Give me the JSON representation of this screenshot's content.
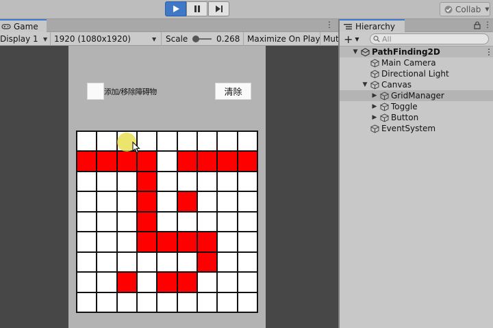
{
  "toolbar": {
    "collab_label": "Collab"
  },
  "game": {
    "tab_label": "Game",
    "display_label": "Display 1",
    "resolution_label": "1920 (1080x1920)",
    "scale_label": "Scale",
    "scale_value": "0.268",
    "maximize_label": "Maximize On Play",
    "mute_label": "Mut",
    "toggle_label": "添加/移除障碍物",
    "clear_label": "清除",
    "grid": {
      "rows": 9,
      "cols": 9,
      "obstacles": [
        [
          1,
          0
        ],
        [
          1,
          1
        ],
        [
          1,
          2
        ],
        [
          1,
          3
        ],
        [
          1,
          5
        ],
        [
          1,
          6
        ],
        [
          1,
          7
        ],
        [
          1,
          8
        ],
        [
          2,
          3
        ],
        [
          3,
          3
        ],
        [
          3,
          5
        ],
        [
          4,
          3
        ],
        [
          5,
          3
        ],
        [
          5,
          4
        ],
        [
          5,
          5
        ],
        [
          5,
          6
        ],
        [
          6,
          6
        ],
        [
          7,
          2
        ],
        [
          7,
          4
        ],
        [
          7,
          5
        ]
      ]
    },
    "colors": {
      "obstacle": "#ff0000",
      "empty": "#ffffff",
      "highlight": "#e6dc3c"
    }
  },
  "hierarchy": {
    "tab_label": "Hierarchy",
    "search_placeholder": "All",
    "items": [
      {
        "label": "PathFinding2D",
        "depth": 0,
        "fold": "expanded",
        "type": "scene"
      },
      {
        "label": "Main Camera",
        "depth": 1,
        "fold": "none",
        "type": "object"
      },
      {
        "label": "Directional Light",
        "depth": 1,
        "fold": "none",
        "type": "object"
      },
      {
        "label": "Canvas",
        "depth": 1,
        "fold": "expanded",
        "type": "object"
      },
      {
        "label": "GridManager",
        "depth": 2,
        "fold": "collapsed",
        "type": "object",
        "selected": true
      },
      {
        "label": "Toggle",
        "depth": 2,
        "fold": "collapsed",
        "type": "object"
      },
      {
        "label": "Button",
        "depth": 2,
        "fold": "collapsed",
        "type": "object"
      },
      {
        "label": "EventSystem",
        "depth": 1,
        "fold": "none",
        "type": "object"
      }
    ]
  }
}
